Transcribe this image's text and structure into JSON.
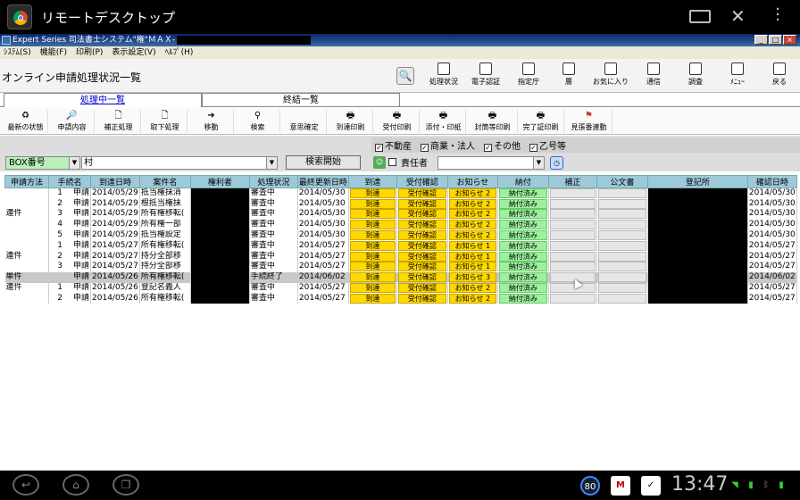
{
  "android": {
    "title": "リモートデスクトップ",
    "clock": "13:47",
    "badge_80": "80"
  },
  "window": {
    "title": "Expert Series 司法書士システム\"権\"ＭＡＸ-",
    "menus": [
      "ｼｽﾃﾑ(S)",
      "機能(F)",
      "印刷(P)",
      "表示設定(V)",
      "ﾍﾙﾌﾟ(H)"
    ]
  },
  "header": {
    "page_title": "オンライン申請処理状況一覧",
    "buttons": [
      "処理状況",
      "電子認証",
      "指定庁",
      "層",
      "お気に入り",
      "通信",
      "調査",
      "ﾒﾆｭｰ",
      "戻る"
    ]
  },
  "tabs": [
    "処理中一覧",
    "終結一覧"
  ],
  "actions": [
    "最新の状態",
    "申請内容",
    "補正処理",
    "取下処理",
    "移動",
    "検索",
    "意思確定",
    "到達印刷",
    "受付印刷",
    "添付・印紙",
    "封筒等印刷",
    "完了証印刷",
    "見張番連動"
  ],
  "filters": {
    "checks": [
      "不動産",
      "商業・法人",
      "その他",
      "乙号等"
    ],
    "box_select": "BOX番号",
    "keyword": "村",
    "search_button": "検索開始",
    "responsible_label": "責任者"
  },
  "table": {
    "columns": [
      "申請方法",
      "手続名",
      "到達日時",
      "案件名",
      "権利者",
      "処理状況",
      "最終更新日時",
      "到達",
      "受付確認",
      "お知らせ",
      "納付",
      "補正",
      "公文書",
      "登記所",
      "確認日時"
    ],
    "rows": [
      {
        "method": "",
        "no": "1",
        "proc": "申請",
        "date": "2014/05/29",
        "case": "抵当権抹消",
        "status": "審査中",
        "updated": "2014/05/30",
        "arrival": "到達",
        "receipt": "受付確認",
        "notice": "お知らせ 2",
        "payment": "納付済み",
        "confirmed": "2014/05/30"
      },
      {
        "method": "",
        "no": "2",
        "proc": "申請",
        "date": "2014/05/29",
        "case": "根抵当権抹",
        "status": "審査中",
        "updated": "2014/05/30",
        "arrival": "到達",
        "receipt": "受付確認",
        "notice": "お知らせ 2",
        "payment": "納付済み",
        "confirmed": "2014/05/30"
      },
      {
        "method": "連件",
        "no": "3",
        "proc": "申請",
        "date": "2014/05/29",
        "case": "所有権移転(",
        "status": "審査中",
        "updated": "2014/05/30",
        "arrival": "到達",
        "receipt": "受付確認",
        "notice": "お知らせ 2",
        "payment": "納付済み",
        "confirmed": "2014/05/30"
      },
      {
        "method": "",
        "no": "4",
        "proc": "申請",
        "date": "2014/05/29",
        "case": "所有権一部",
        "status": "審査中",
        "updated": "2014/05/30",
        "arrival": "到達",
        "receipt": "受付確認",
        "notice": "お知らせ 2",
        "payment": "納付済み",
        "confirmed": "2014/05/30"
      },
      {
        "method": "",
        "no": "5",
        "proc": "申請",
        "date": "2014/05/29",
        "case": "抵当権設定",
        "status": "審査中",
        "updated": "2014/05/30",
        "arrival": "到達",
        "receipt": "受付確認",
        "notice": "お知らせ 2",
        "payment": "納付済み",
        "confirmed": "2014/05/30"
      },
      {
        "method": "",
        "no": "1",
        "proc": "申請",
        "date": "2014/05/27",
        "case": "所有権移転(",
        "status": "審査中",
        "updated": "2014/05/27",
        "arrival": "到達",
        "receipt": "受付確認",
        "notice": "お知らせ 1",
        "payment": "納付済み",
        "confirmed": "2014/05/27"
      },
      {
        "method": "連件",
        "no": "2",
        "proc": "申請",
        "date": "2014/05/27",
        "case": "持分全部移",
        "status": "審査中",
        "updated": "2014/05/27",
        "arrival": "到達",
        "receipt": "受付確認",
        "notice": "お知らせ 1",
        "payment": "納付済み",
        "confirmed": "2014/05/27"
      },
      {
        "method": "",
        "no": "3",
        "proc": "申請",
        "date": "2014/05/27",
        "case": "持分全部移",
        "status": "審査中",
        "updated": "2014/05/27",
        "arrival": "到達",
        "receipt": "受付確認",
        "notice": "お知らせ 1",
        "payment": "納付済み",
        "confirmed": "2014/05/27"
      },
      {
        "method": "単件",
        "no": "",
        "proc": "申請",
        "date": "2014/05/26",
        "case": "所有権移転(",
        "status": "手続終了",
        "updated": "2014/06/02",
        "arrival": "到達",
        "receipt": "受付確認",
        "notice": "お知らせ 3",
        "payment": "納付済み",
        "confirmed": "2014/06/02"
      },
      {
        "method": "連件",
        "no": "1",
        "proc": "申請",
        "date": "2014/05/26",
        "case": "登記名義人",
        "status": "審査中",
        "updated": "2014/05/27",
        "arrival": "到達",
        "receipt": "受付確認",
        "notice": "お知らせ 2",
        "payment": "納付済み",
        "confirmed": "2014/05/27"
      },
      {
        "method": "",
        "no": "2",
        "proc": "申請",
        "date": "2014/05/26",
        "case": "所有権移転(",
        "status": "審査中",
        "updated": "2014/05/27",
        "arrival": "到達",
        "receipt": "受付確認",
        "notice": "お知らせ 2",
        "payment": "納付済み",
        "confirmed": "2014/05/27"
      }
    ]
  }
}
